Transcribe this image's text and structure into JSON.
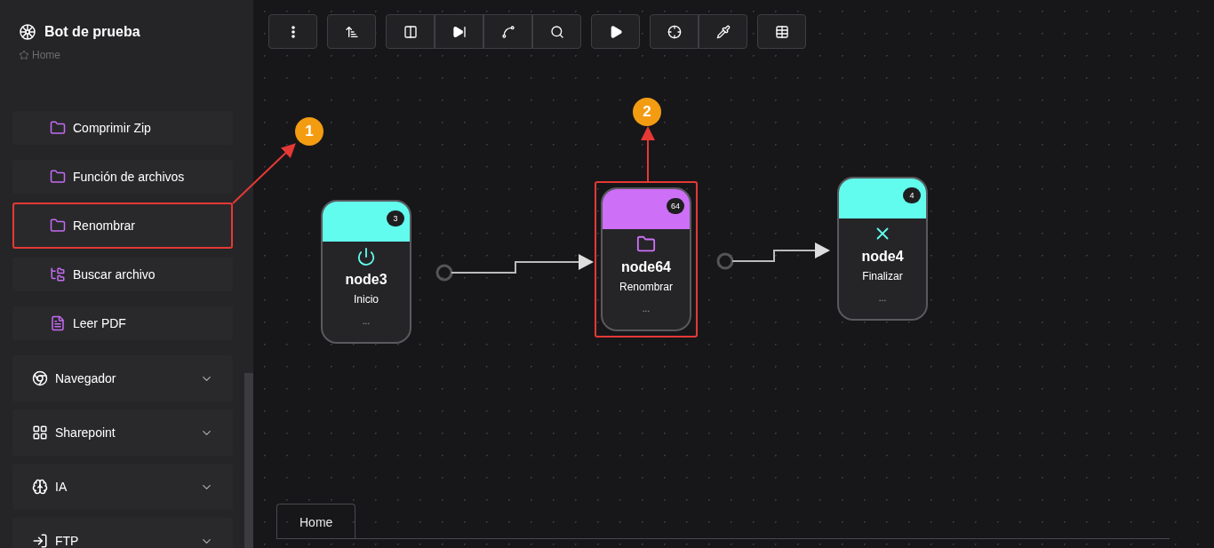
{
  "sidebar": {
    "title": "Bot de prueba",
    "breadcrumb": "Home",
    "items": [
      {
        "kind": "sub",
        "label": "Comprimir Zip",
        "annotated": false
      },
      {
        "kind": "sub",
        "label": "Función de archivos",
        "annotated": false
      },
      {
        "kind": "sub",
        "label": "Renombrar",
        "annotated": true
      },
      {
        "kind": "sub",
        "label": "Buscar archivo",
        "annotated": false
      },
      {
        "kind": "sub",
        "label": "Leer PDF",
        "annotated": false
      },
      {
        "kind": "group",
        "label": "Navegador",
        "annotated": false
      },
      {
        "kind": "group",
        "label": "Sharepoint",
        "annotated": false
      },
      {
        "kind": "group",
        "label": "IA",
        "annotated": false
      },
      {
        "kind": "group",
        "label": "FTP",
        "annotated": false
      }
    ]
  },
  "nodes": [
    {
      "badge": "3",
      "title": "node3",
      "label": "Inicio",
      "footer": "...",
      "color": "#62fcee",
      "annotated": false
    },
    {
      "badge": "64",
      "title": "node64",
      "label": "Renombrar",
      "footer": "...",
      "color": "#cd6ff7",
      "annotated": true
    },
    {
      "badge": "4",
      "title": "node4",
      "label": "Finalizar",
      "footer": "...",
      "color": "#62fcee",
      "annotated": false
    }
  ],
  "callouts": [
    "1",
    "2"
  ],
  "tabs": [
    {
      "label": "Home",
      "selected": true
    }
  ]
}
